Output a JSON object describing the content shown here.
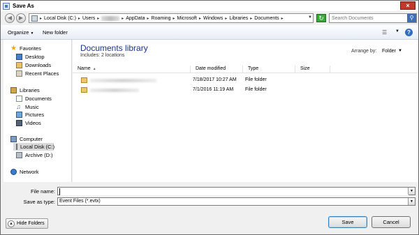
{
  "window": {
    "title": "Save As",
    "close_label": "×"
  },
  "address": {
    "crumbs": [
      "Local Disk (C:)",
      "Users",
      "AppData",
      "Roaming",
      "Microsoft",
      "Windows",
      "Libraries",
      "Documents"
    ]
  },
  "search": {
    "placeholder": "Search Documents"
  },
  "toolbar": {
    "organize_label": "Organize",
    "new_folder_label": "New folder"
  },
  "nav": {
    "favorites": "Favorites",
    "desktop": "Desktop",
    "downloads": "Downloads",
    "recent_places": "Recent Places",
    "libraries": "Libraries",
    "documents": "Documents",
    "music": "Music",
    "pictures": "Pictures",
    "videos": "Videos",
    "computer": "Computer",
    "local_disk": "Local Disk (C:)",
    "archive": "Archive (D:)",
    "network": "Network"
  },
  "library": {
    "title": "Documents library",
    "subtitle": "Includes: 2 locations",
    "arrange_label": "Arrange by:",
    "arrange_value": "Folder"
  },
  "columns": {
    "name": "Name",
    "date": "Date modified",
    "type": "Type",
    "size": "Size"
  },
  "files": [
    {
      "date": "7/18/2017 10:27 AM",
      "type": "File folder"
    },
    {
      "date": "7/1/2016 11:19 AM",
      "type": "File folder"
    }
  ],
  "form": {
    "file_name_label": "File name:",
    "file_name_value": "",
    "save_type_label": "Save as type:",
    "save_type_value": "Event Files (*.evtx)"
  },
  "buttons": {
    "hide_folders": "Hide Folders",
    "save": "Save",
    "cancel": "Cancel"
  }
}
